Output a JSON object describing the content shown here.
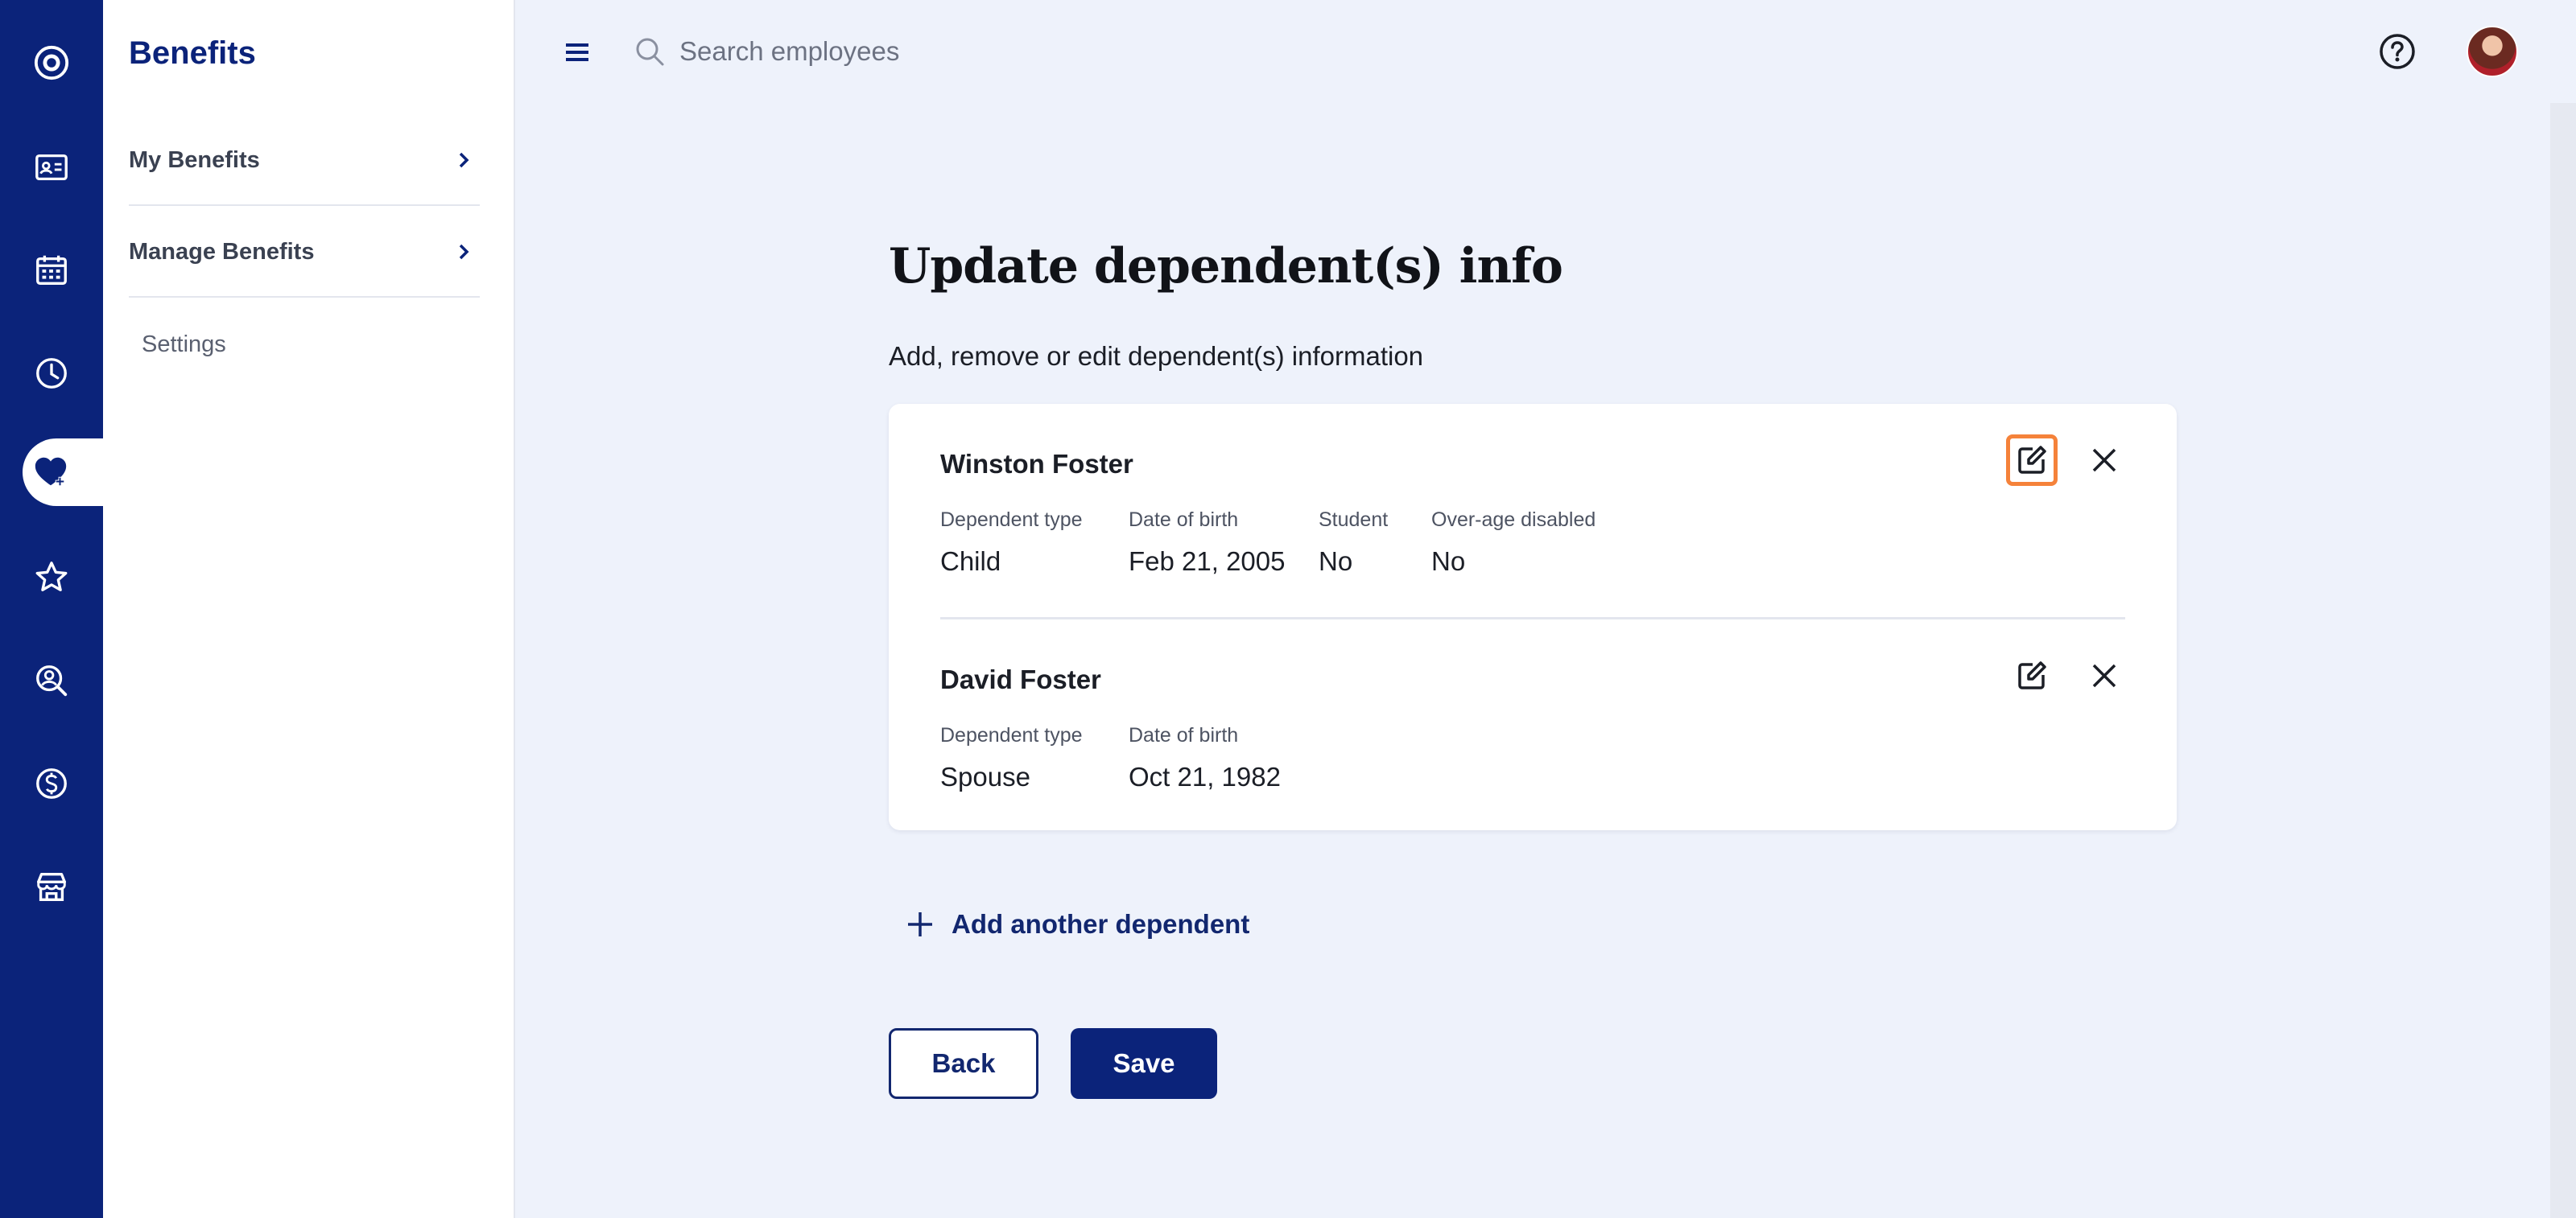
{
  "rail": {
    "icons": [
      "logo-icon",
      "id-card-icon",
      "calendar-icon",
      "clock-icon",
      "heart-plus-icon",
      "star-icon",
      "person-search-icon",
      "dollar-icon",
      "store-icon"
    ]
  },
  "subnav": {
    "title": "Benefits",
    "items": [
      {
        "label": "My Benefits"
      },
      {
        "label": "Manage Benefits"
      }
    ],
    "settings_label": "Settings"
  },
  "search": {
    "placeholder": "Search employees"
  },
  "page": {
    "title": "Update dependent(s) info",
    "subtitle": "Add, remove or edit dependent(s) information"
  },
  "dependents": [
    {
      "name": "Winston Foster",
      "fields": [
        {
          "label": "Dependent type",
          "value": "Child"
        },
        {
          "label": "Date of birth",
          "value": "Feb 21, 2005"
        },
        {
          "label": "Student",
          "value": "No"
        },
        {
          "label": "Over-age disabled",
          "value": "No"
        }
      ]
    },
    {
      "name": "David Foster",
      "fields": [
        {
          "label": "Dependent type",
          "value": "Spouse"
        },
        {
          "label": "Date of birth",
          "value": "Oct 21, 1982"
        }
      ]
    }
  ],
  "actions": {
    "add_dependent": "Add another dependent",
    "back": "Back",
    "save": "Save"
  },
  "colors": {
    "brand": "#0b237a",
    "focus": "#f5823a",
    "background": "#eef2fb"
  }
}
